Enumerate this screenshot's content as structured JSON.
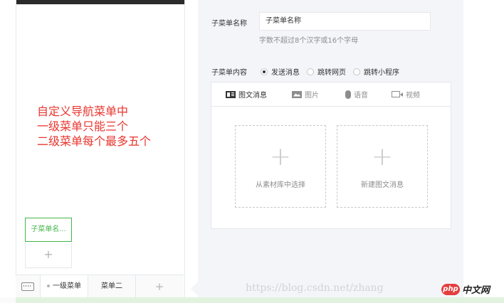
{
  "preview": {
    "annotation_lines": [
      "自定义导航菜单中",
      "一级菜单只能三个",
      "二级菜单每个最多五个"
    ],
    "submenu_active_label": "子菜单名...",
    "submenu_add_symbol": "+",
    "menubar": {
      "keyboard_icon": "keyboard-icon",
      "menu1_label": "一级菜单",
      "menu2_label": "菜单二",
      "menu3_add_symbol": "+"
    }
  },
  "editor": {
    "name_label": "子菜单名称",
    "name_value": "子菜单名称",
    "name_hint": "字数不超过8个汉字或16个字母",
    "content_label": "子菜单内容",
    "content_options": [
      {
        "label": "发送消息",
        "checked": true
      },
      {
        "label": "跳转网页",
        "checked": false
      },
      {
        "label": "跳转小程序",
        "checked": false
      }
    ],
    "tabs": [
      {
        "label": "图文消息",
        "icon": "news-icon"
      },
      {
        "label": "图片",
        "icon": "image-icon"
      },
      {
        "label": "语音",
        "icon": "voice-icon"
      },
      {
        "label": "视频",
        "icon": "video-icon"
      }
    ],
    "pick_from_library": {
      "symbol": "+",
      "label": "从素材库中选择"
    },
    "new_news": {
      "symbol": "+",
      "label": "新建图文消息"
    }
  },
  "watermark": "https://blog.csdn.net/zhang",
  "logo": {
    "badge": "php",
    "text": "中文网"
  }
}
